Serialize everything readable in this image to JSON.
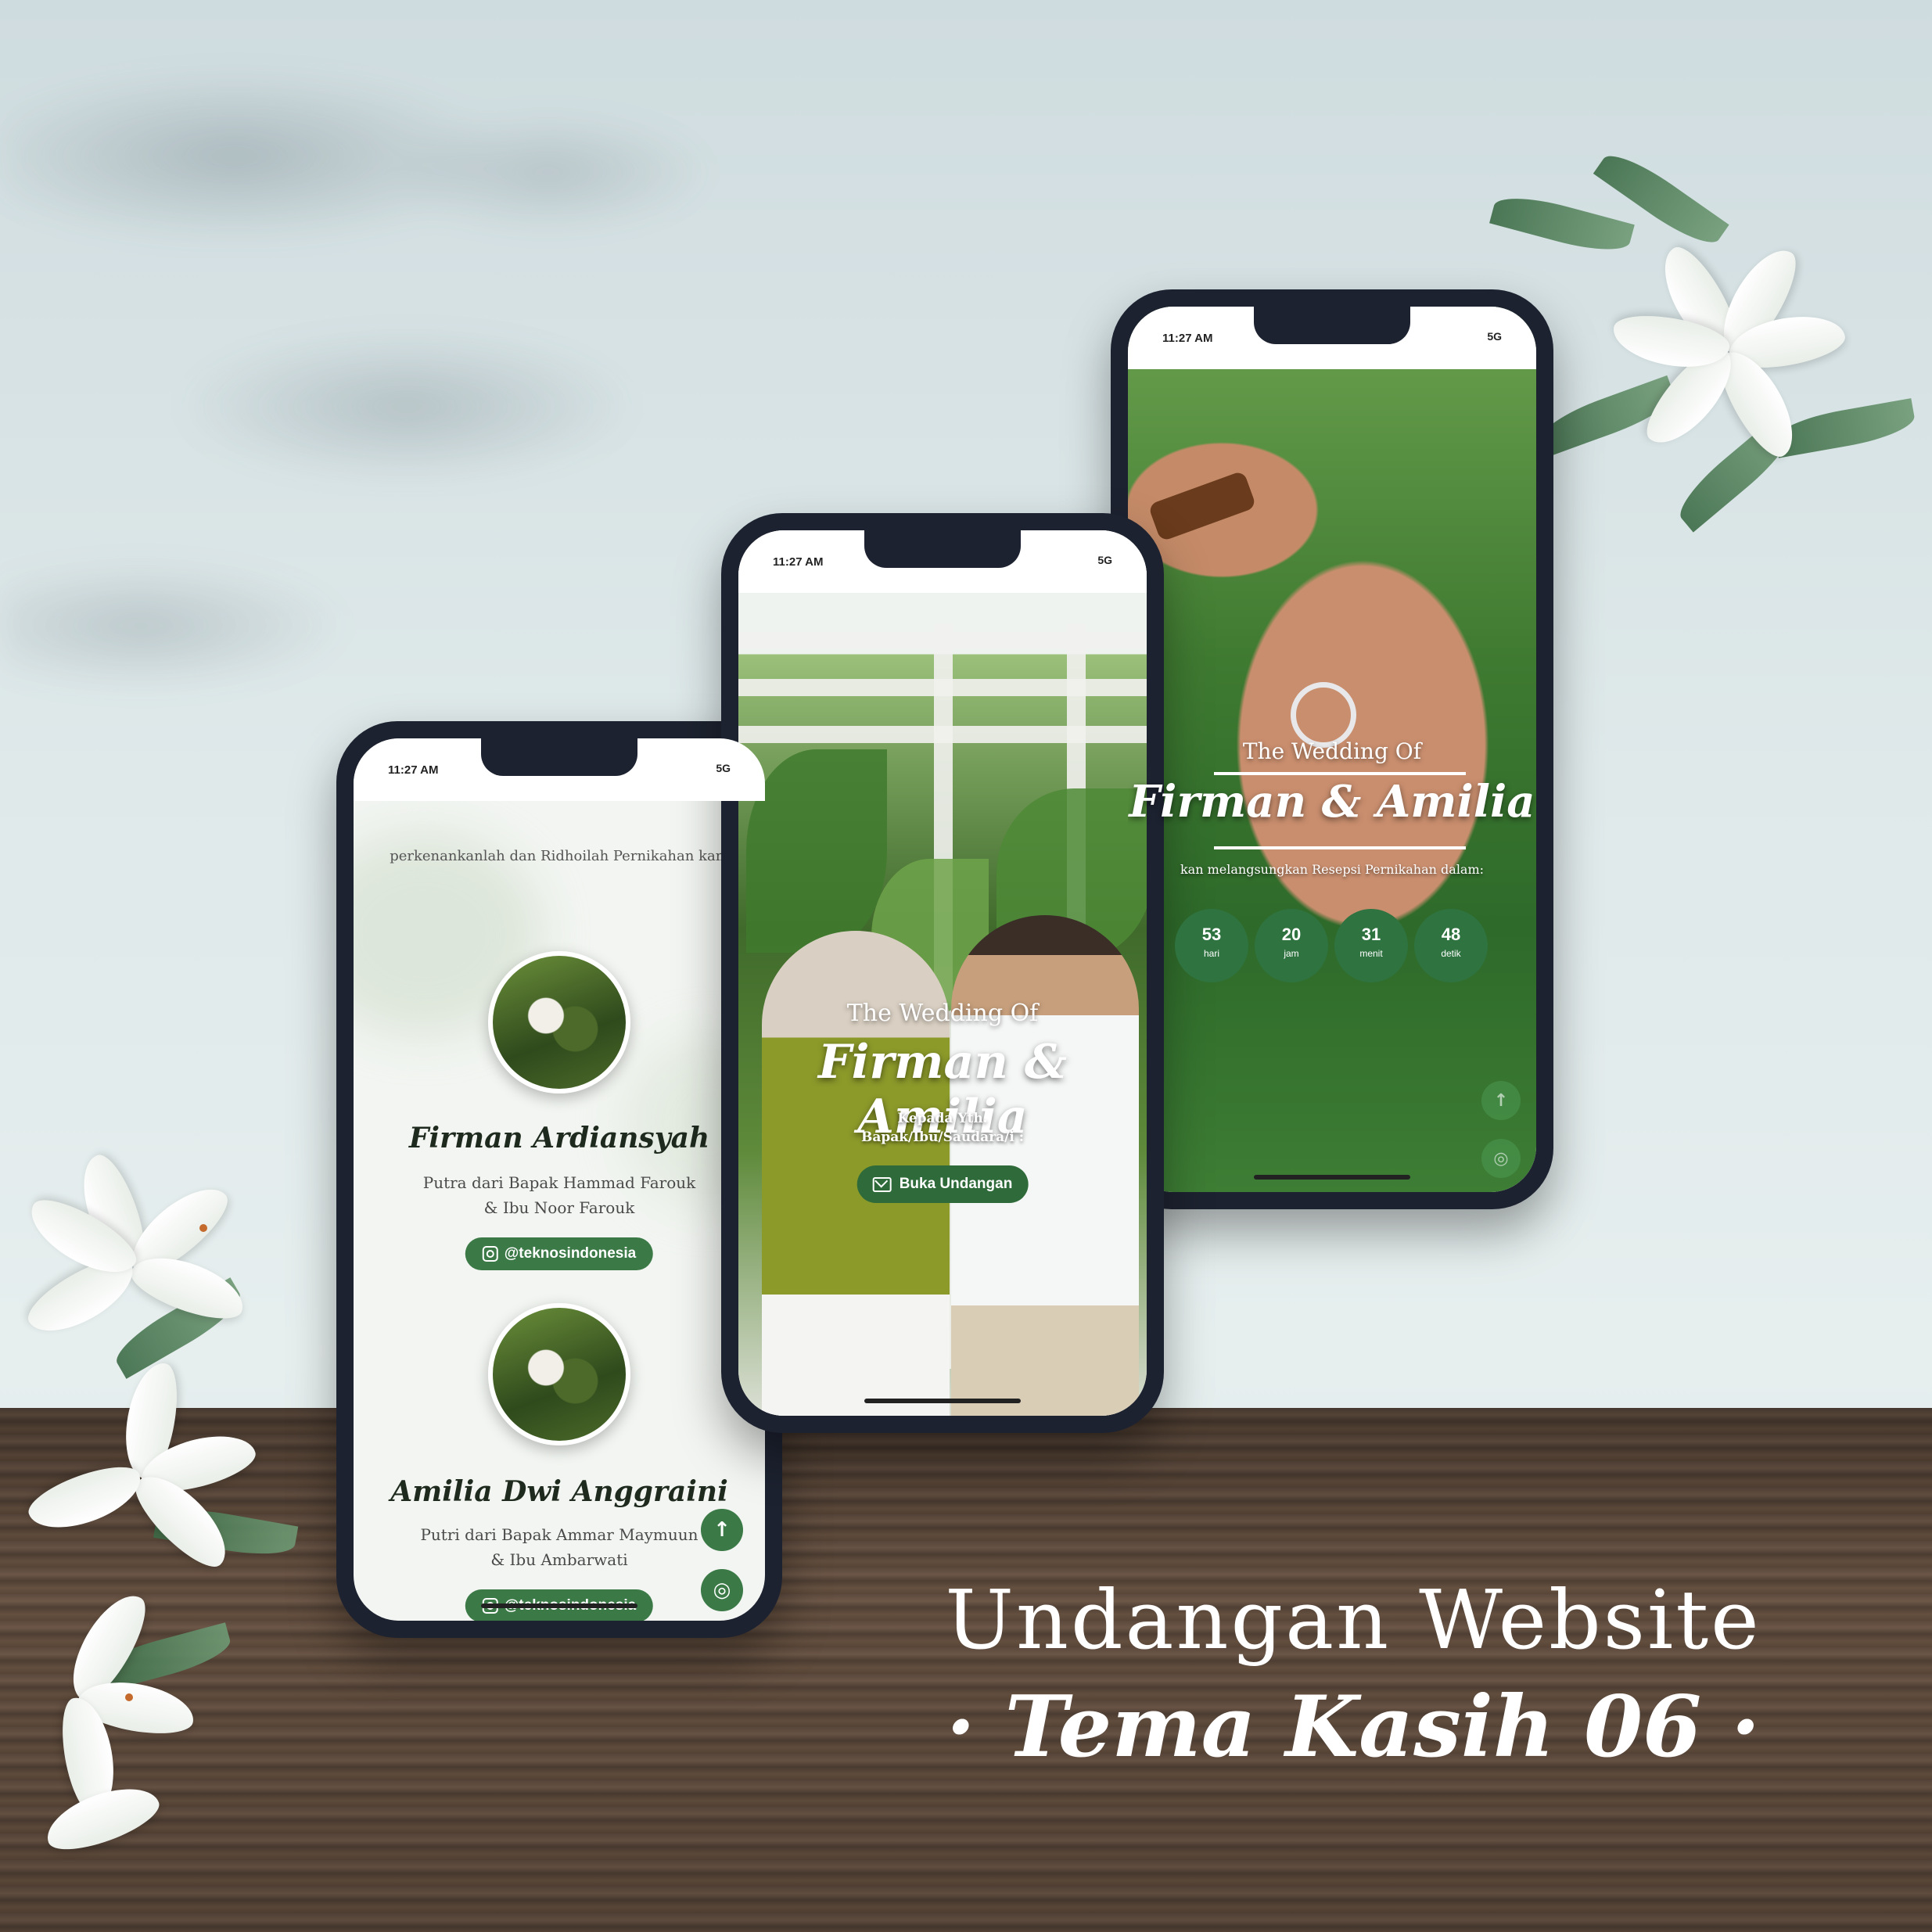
{
  "headline": {
    "line1": "Undangan Website",
    "line2": "· Tema Kasih 06 ·"
  },
  "phones": {
    "time": "11:27 AM",
    "signal": "5G",
    "left": {
      "intro": "perkenankanlah dan Ridhoilah Pernikahan kam",
      "groom": {
        "name": "Firman Ardiansyah",
        "parents_1": "Putra dari Bapak Hammad Farouk",
        "parents_2": "& Ibu Noor Farouk",
        "instagram": "@teknosindonesia"
      },
      "bride": {
        "name": "Amilia Dwi Anggraini",
        "parents_1": "Putri dari Bapak Ammar Maymuun",
        "parents_2": "& Ibu Ambarwati",
        "instagram": "@teknosindonesia"
      }
    },
    "middle": {
      "title": "The Wedding Of",
      "names": "Firman & Amilia",
      "guest_1": "Kepada Yth.",
      "guest_2": "Bapak/Ibu/Saudara/i :",
      "open_button": "Buka Undangan"
    },
    "right": {
      "title": "The Wedding Of",
      "names": "Firman & Amilia",
      "subtitle": "kan melangsungkan Resepsi Pernikahan dalam:",
      "countdown": [
        {
          "value": "53",
          "unit": "hari"
        },
        {
          "value": "20",
          "unit": "jam"
        },
        {
          "value": "31",
          "unit": "menit"
        },
        {
          "value": "48",
          "unit": "detik"
        }
      ]
    }
  },
  "colors": {
    "accent": "#3b7a47",
    "background": "#dfe9ea",
    "wood": "#5d4a3e"
  },
  "icons": [
    "instagram-icon",
    "envelope-icon",
    "arrow-up-icon",
    "music-icon"
  ]
}
